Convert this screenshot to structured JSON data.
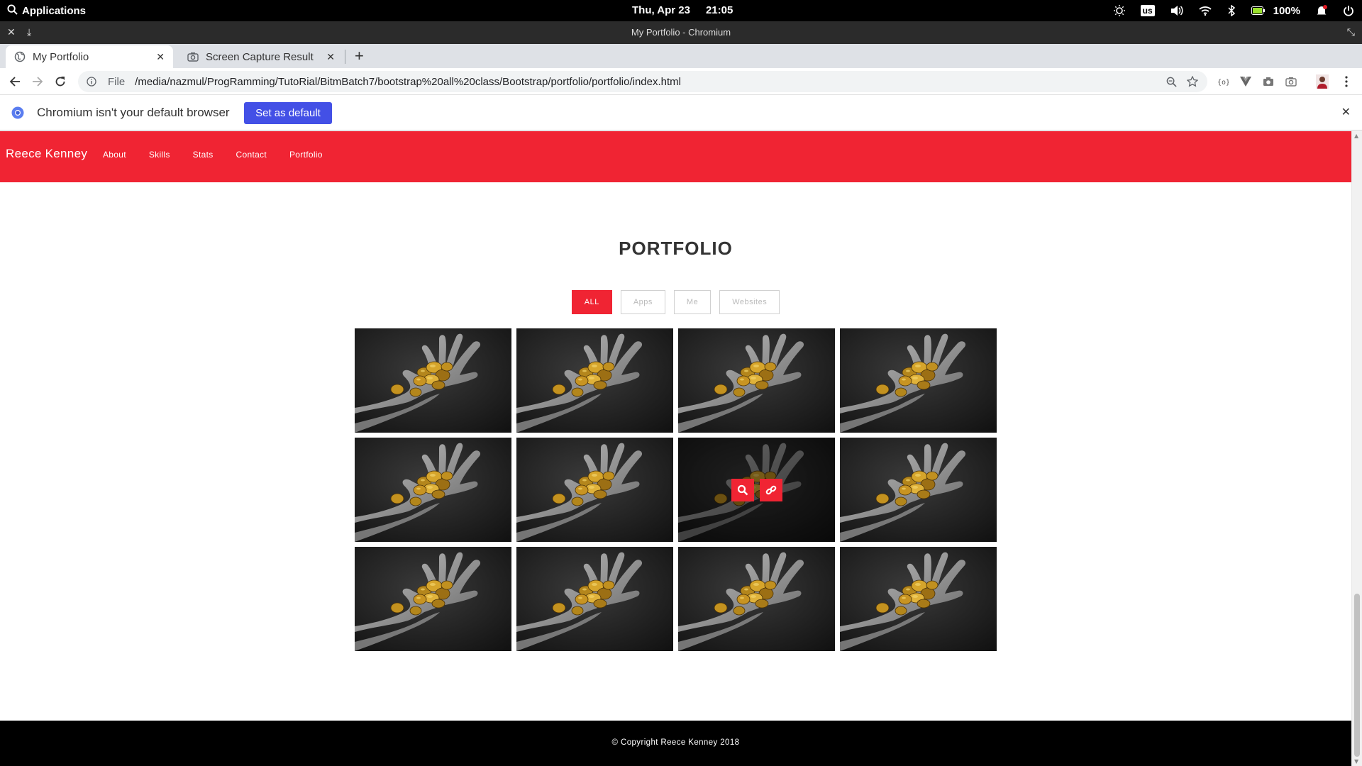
{
  "system": {
    "apps_label": "Applications",
    "date": "Thu, Apr 23",
    "time": "21:05",
    "keyboard": "us",
    "battery": "100%"
  },
  "window": {
    "title": "My Portfolio - Chromium"
  },
  "tabs": [
    {
      "title": "My Portfolio",
      "active": true
    },
    {
      "title": "Screen Capture Result",
      "active": false
    }
  ],
  "toolbar": {
    "scheme": "File",
    "url": "/media/nazmul/ProgRamming/TutoRial/BitmBatch7/bootstrap%20all%20class/Bootstrap/portfolio/portfolio/index.html"
  },
  "infobar": {
    "message": "Chromium isn't your default browser",
    "button": "Set as default"
  },
  "site": {
    "brand": "Reece Kenney",
    "nav": [
      "About",
      "Skills",
      "Stats",
      "Contact",
      "Portfolio"
    ],
    "accent": "#f02433",
    "section_title": "PORTFOLIO",
    "filters": [
      {
        "label": "ALL",
        "active": true
      },
      {
        "label": "Apps",
        "active": false
      },
      {
        "label": "Me",
        "active": false
      },
      {
        "label": "Websites",
        "active": false
      }
    ],
    "tiles": 12,
    "hovered_tile": 7,
    "footer": "© Copyright Reece Kenney 2018"
  }
}
